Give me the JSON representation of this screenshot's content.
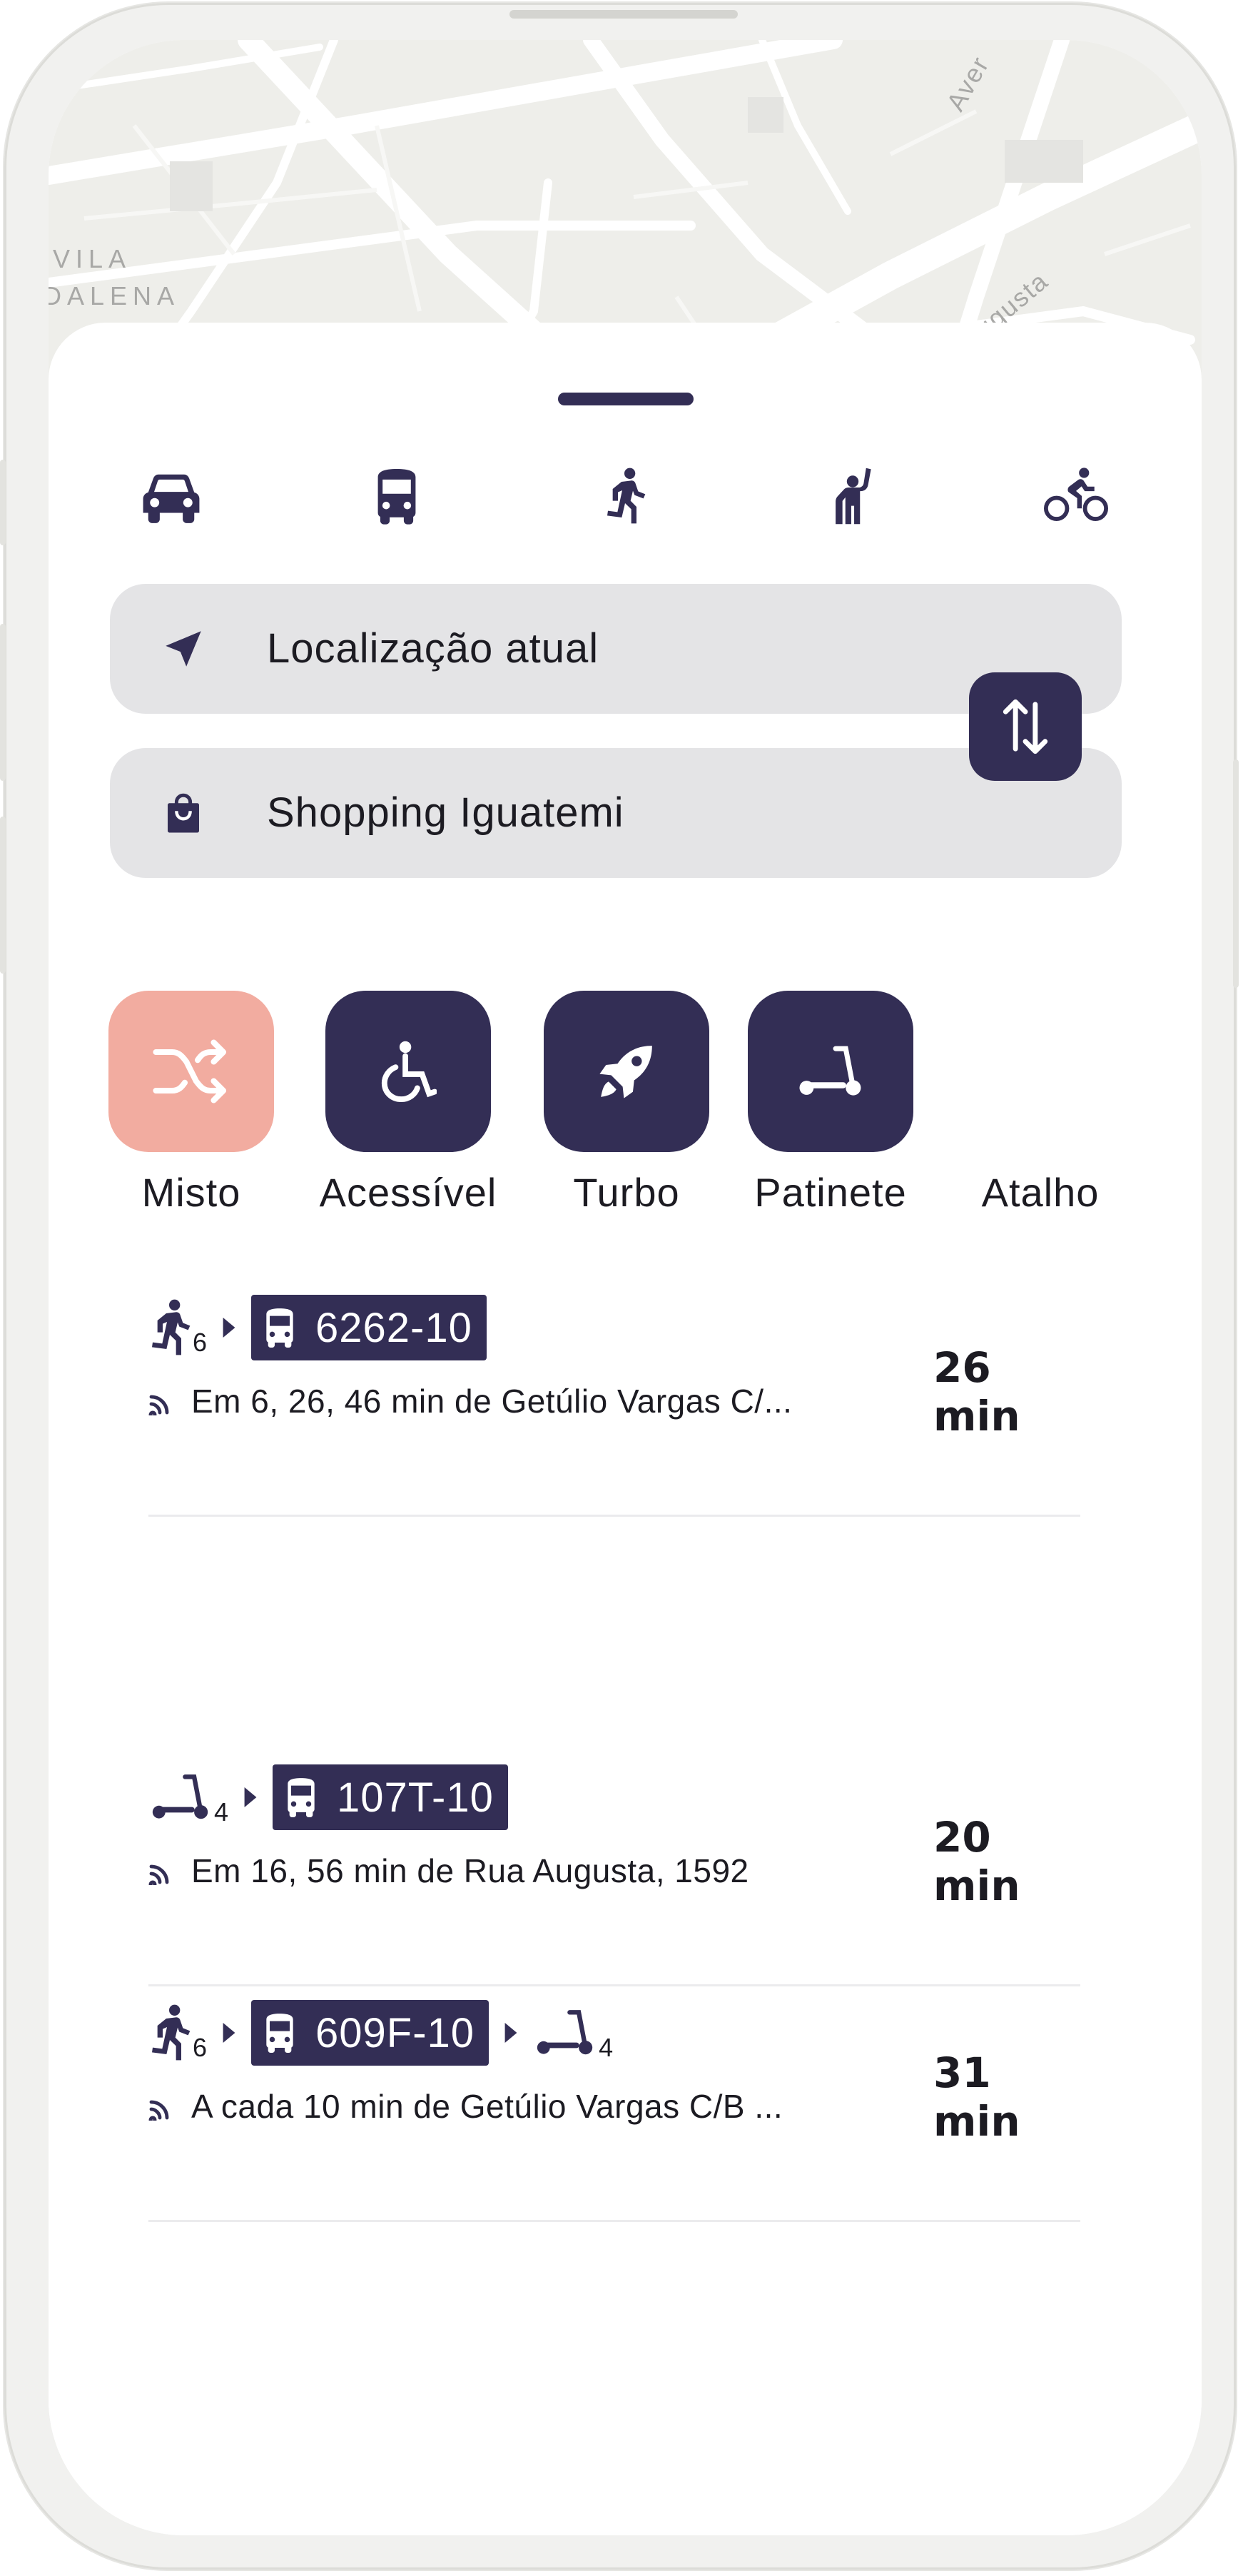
{
  "map": {
    "labels": [
      "VILA",
      "DALENA",
      "Aver",
      "ugusta"
    ]
  },
  "transport_modes": [
    {
      "name": "car-icon"
    },
    {
      "name": "bus-icon"
    },
    {
      "name": "walk-icon"
    },
    {
      "name": "ride-hail-icon"
    },
    {
      "name": "bike-icon"
    }
  ],
  "origin": {
    "value": "Localização atual",
    "icon": "navigation-arrow-icon"
  },
  "destination": {
    "value": "Shopping Iguatemi",
    "icon": "shopping-bag-icon"
  },
  "swap_button": {
    "icon": "swap-vertical-icon"
  },
  "filters": [
    {
      "label": "Misto",
      "icon": "shuffle-icon",
      "active": true
    },
    {
      "label": "Acessível",
      "icon": "wheelchair-icon",
      "active": false
    },
    {
      "label": "Turbo",
      "icon": "rocket-icon",
      "active": false
    },
    {
      "label": "Patinete",
      "icon": "scooter-icon",
      "active": false
    },
    {
      "label": "Atalho",
      "icon": "",
      "active": false
    }
  ],
  "routes": [
    {
      "first_leg": {
        "icon": "walk-icon",
        "sub": "6"
      },
      "bus_line": "6262-10",
      "info": "Em 6, 26, 46 min de Getúlio Vargas C/...",
      "duration": "26 min"
    },
    {
      "first_leg": {
        "icon": "scooter-icon",
        "sub": "4"
      },
      "bus_line": "107T-10",
      "info": "Em 16, 56 min de Rua Augusta, 1592",
      "duration": "20 min"
    },
    {
      "first_leg": {
        "icon": "walk-icon",
        "sub": "6"
      },
      "bus_line": "609F-10",
      "last_leg": {
        "icon": "scooter-icon",
        "sub": "4"
      },
      "info": "A cada 10 min de Getúlio Vargas C/B ...",
      "duration": "31 min"
    }
  ],
  "colors": {
    "primary": "#332e55",
    "accent": "#f2aca0",
    "field": "#e4e4e6"
  }
}
